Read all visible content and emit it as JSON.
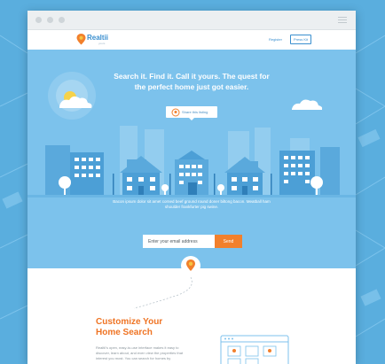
{
  "browser": {
    "menu_icon": "hamburger-icon"
  },
  "navbar": {
    "logo_text": "Realtii",
    "logo_sub": "yours",
    "register_label": "Register",
    "press_kit_label": "Press Kit"
  },
  "hero": {
    "title": "Search it. Find it. Call it yours. The quest for the perfect home just got easier.",
    "share_label": "Share this listing",
    "body": "Bacon ipsum dolor sit amet corned beef ground round doner biltong bacon. Meatball ham shoulder frankfurter pig swine.",
    "email_placeholder": "Enter your email address",
    "send_label": "Send"
  },
  "feature": {
    "title_line1": "Customize Your",
    "title_line2": "Home Search",
    "body": "Realtii's open, easy-to-use interface makes it easy to discover, learn about, and even view the properties that interest you most. You can search for homes by"
  },
  "colors": {
    "accent": "#f2802c",
    "brand_blue": "#3a8fcf",
    "hero_bg": "#7cc2ec",
    "page_bg": "#5fb0e0"
  }
}
